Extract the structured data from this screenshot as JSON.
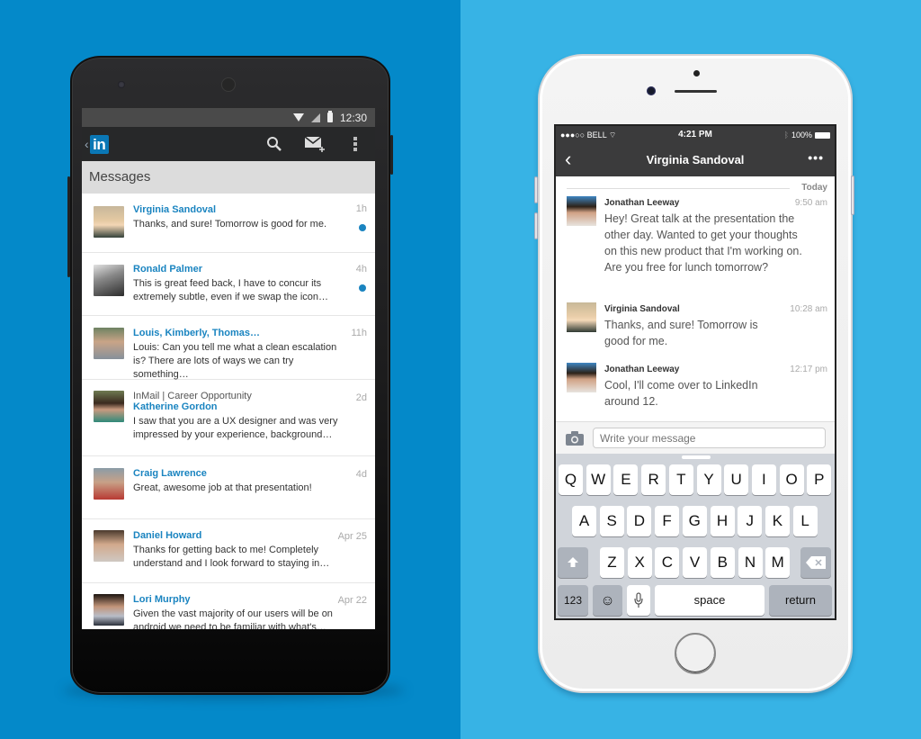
{
  "android": {
    "status_bar": {
      "time": "12:30",
      "icons": [
        "wifi-icon",
        "signal-icon",
        "battery-icon"
      ]
    },
    "action_bar": {
      "logo_text": "in",
      "actions": [
        "search-icon",
        "compose-message-icon",
        "overflow-menu-icon"
      ]
    },
    "section_title": "Messages",
    "messages": [
      {
        "name": "Virginia Sandoval",
        "time": "1h",
        "preview": "Thanks, and sure! Tomorrow is good for me.",
        "unread": true
      },
      {
        "name": "Ronald Palmer",
        "time": "4h",
        "preview": "This is great feed back, I have to concur its extremely subtle, even if we swap the icon…",
        "unread": true
      },
      {
        "name": "Louis, Kimberly, Thomas…",
        "time": "11h",
        "preview": "Louis: Can you tell me what a clean escalation is? There are lots of ways we can try something…",
        "unread": false
      },
      {
        "subject": "InMail | Career Opportunity",
        "name": "Katherine Gordon",
        "time": "2d",
        "preview": "I saw that you are a UX designer and was very impressed by your experience, background…",
        "unread": false
      },
      {
        "name": "Craig Lawrence",
        "time": "4d",
        "preview": "Great, awesome job at that presentation!",
        "unread": false
      },
      {
        "name": "Daniel Howard",
        "time": "Apr 25",
        "preview": "Thanks for getting back to me! Completely understand and I look forward to staying in…",
        "unread": false
      },
      {
        "name": "Lori Murphy",
        "time": "Apr 22",
        "preview": "Given the vast majority of our users will be on android we need to be familiar with what's…",
        "unread": false
      }
    ]
  },
  "iphone": {
    "status_bar": {
      "carrier": "●●●○○ BELL",
      "time": "4:21 PM",
      "battery": "100%"
    },
    "nav": {
      "back": "‹",
      "title": "Virginia Sandoval",
      "more": "•••"
    },
    "date_label": "Today",
    "messages": [
      {
        "sender": "Jonathan Leeway",
        "time": "9:50 am",
        "text": "Hey! Great talk at the presentation the other day. Wanted to get your thoughts on this new product that I'm working on. Are you free for lunch tomorrow?"
      },
      {
        "sender": "Virginia Sandoval",
        "time": "10:28 am",
        "text": "Thanks, and sure! Tomorrow is good for me."
      },
      {
        "sender": "Jonathan Leeway",
        "time": "12:17 pm",
        "text": "Cool, I'll come over to LinkedIn around 12."
      }
    ],
    "composer": {
      "placeholder": "Write your message"
    },
    "keyboard": {
      "row1": [
        "Q",
        "W",
        "E",
        "R",
        "T",
        "Y",
        "U",
        "I",
        "O",
        "P"
      ],
      "row2": [
        "A",
        "S",
        "D",
        "F",
        "G",
        "H",
        "J",
        "K",
        "L"
      ],
      "row3": [
        "Z",
        "X",
        "C",
        "V",
        "B",
        "N",
        "M"
      ],
      "numbers": "123",
      "space": "space",
      "return": "return"
    }
  },
  "colors": {
    "linkedin_blue": "#0a77b5",
    "name_blue": "#1a84c0",
    "bg_left": "#0489c9",
    "bg_right": "#37b3e5"
  }
}
